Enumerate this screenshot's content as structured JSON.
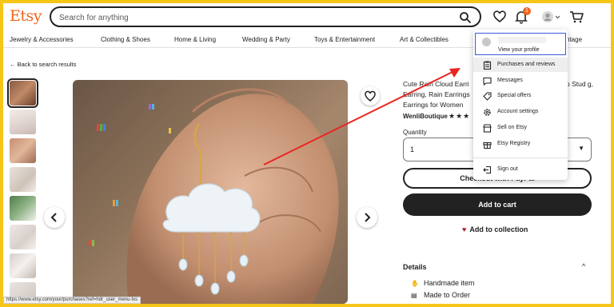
{
  "header": {
    "logo": "Etsy",
    "search_placeholder": "Search for anything",
    "notification_count": "1"
  },
  "categories": [
    "Jewelry & Accessories",
    "Clothing & Shoes",
    "Home & Living",
    "Wedding & Party",
    "Toys & Entertainment",
    "Art & Collectibles",
    "ntage"
  ],
  "back_link": "← Back to search results",
  "product": {
    "title": "Cute Rain Cloud Earri",
    "title_tail": "p Stud g,",
    "title_line2": "Earring, Rain Earrings",
    "title_line3": "Earrings for Women",
    "shop": "WenliBoutique",
    "stars": "★★★",
    "quantity_label": "Quantity",
    "quantity_value": "1",
    "checkout_label": "Checkout with PayPal",
    "add_to_cart": "Add to cart",
    "add_to_collection": "Add to collection"
  },
  "details": {
    "title": "Details",
    "items": [
      "Handmade item",
      "Made to Order"
    ]
  },
  "status_url": "https://www.etsy.com/your/purchases?ref=hdr_user_menu-txs",
  "menu": {
    "profile_label": "View your profile",
    "items": [
      {
        "label": "Purchases and reviews",
        "icon": "clipboard-icon"
      },
      {
        "label": "Messages",
        "icon": "message-icon"
      },
      {
        "label": "Special offers",
        "icon": "tag-icon"
      },
      {
        "label": "Account settings",
        "icon": "gear-icon"
      },
      {
        "label": "Sell on Etsy",
        "icon": "shop-icon"
      },
      {
        "label": "Etsy Registry",
        "icon": "gift-icon"
      }
    ],
    "signout_label": "Sign out"
  },
  "colors": {
    "brand": "#f1641e",
    "annotation_arrow": "#e8251f",
    "page_border": "#f5c518"
  }
}
